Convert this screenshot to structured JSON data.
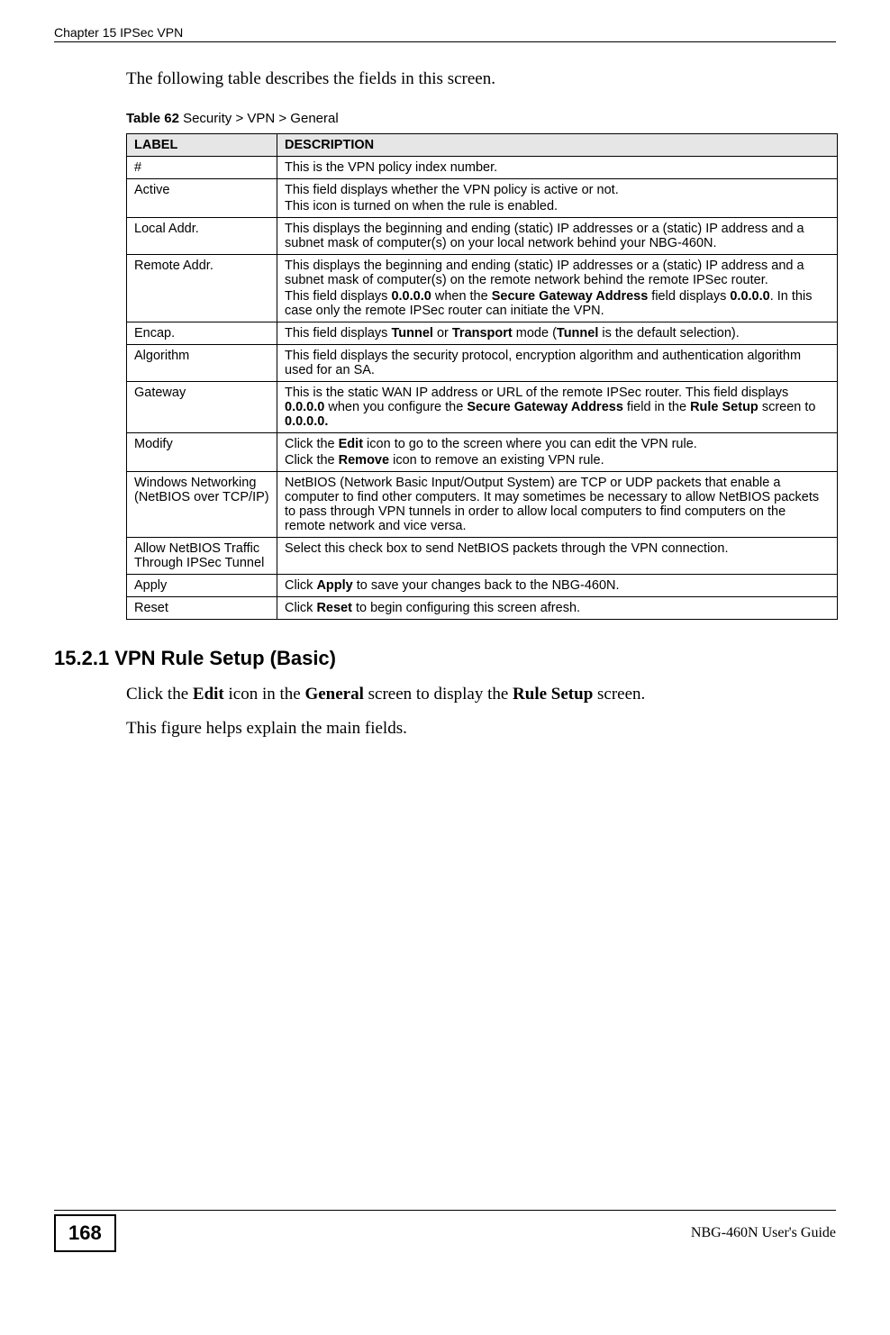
{
  "header": {
    "running": "Chapter 15 IPSec VPN"
  },
  "intro": "The following table describes the fields in this screen.",
  "table": {
    "caption_prefix": "Table 62",
    "caption_rest": "   Security > VPN > General",
    "head_label": "LABEL",
    "head_desc": "DESCRIPTION",
    "rows": [
      {
        "label": "#",
        "desc": "This is the VPN policy index number."
      },
      {
        "label": "Active",
        "desc": "This field displays whether the VPN policy is active or not.",
        "desc2": "This icon is turned on when the rule is enabled."
      },
      {
        "label": "Local Addr.",
        "desc": "This displays the beginning and ending (static) IP addresses or a (static) IP address and a subnet mask of computer(s) on your local network behind your NBG-460N."
      },
      {
        "label": "Remote Addr.",
        "desc": "This displays the beginning and ending (static) IP addresses or a (static) IP address and a subnet mask of computer(s) on the remote network behind the remote IPSec router.",
        "desc2a": "This field displays ",
        "desc2b": "0.0.0.0",
        "desc2c": " when the ",
        "desc2d": "Secure Gateway Address",
        "desc2e": " field displays ",
        "desc2f": "0.0.0.0",
        "desc2g": ". In this case only the remote IPSec router can initiate the VPN."
      },
      {
        "label": "Encap.",
        "p1": "This field displays ",
        "p2": "Tunnel",
        "p3": " or ",
        "p4": "Transport",
        "p5": " mode (",
        "p6": "Tunnel",
        "p7": " is the default selection)."
      },
      {
        "label": "Algorithm",
        "desc": "This field displays the security protocol, encryption algorithm and authentication algorithm used for an SA."
      },
      {
        "label": "Gateway",
        "p1": "This is the static WAN IP address or URL of the remote IPSec router. This field displays ",
        "p2": "0.0.0.0",
        "p3": " when you configure the ",
        "p4": "Secure Gateway Address",
        "p5": " field in the ",
        "p6": "Rule Setup",
        "p7": " screen to ",
        "p8": "0.0.0.0."
      },
      {
        "label": "Modify",
        "l1a": "Click the ",
        "l1b": "Edit",
        "l1c": " icon to go to the screen where you can edit the VPN rule.",
        "l2a": "Click the ",
        "l2b": "Remove",
        "l2c": " icon to remove an existing VPN rule."
      },
      {
        "label": "Windows Networking (NetBIOS over TCP/IP)",
        "desc": "NetBIOS (Network Basic Input/Output System) are TCP or UDP packets that enable a computer to find other computers. It may sometimes be necessary to allow NetBIOS packets to pass through VPN tunnels in order to allow local computers to find computers on the remote network and vice versa."
      },
      {
        "label": "Allow NetBIOS Traffic Through IPSec Tunnel",
        "desc": "Select this check box to send NetBIOS packets through the VPN connection."
      },
      {
        "label": "Apply",
        "p1": "Click ",
        "p2": "Apply",
        "p3": " to save your changes back to the NBG-460N."
      },
      {
        "label": "Reset",
        "p1": "Click ",
        "p2": "Reset",
        "p3": " to begin configuring this screen afresh."
      }
    ]
  },
  "section": {
    "heading": "15.2.1  VPN Rule Setup (Basic)",
    "para1_a": "Click the ",
    "para1_b": "Edit",
    "para1_c": " icon in the ",
    "para1_d": "General",
    "para1_e": " screen to display the ",
    "para1_f": "Rule Setup",
    "para1_g": " screen.",
    "para2": "This figure helps explain the main fields."
  },
  "footer": {
    "page_number": "168",
    "guide": "NBG-460N User's Guide"
  }
}
